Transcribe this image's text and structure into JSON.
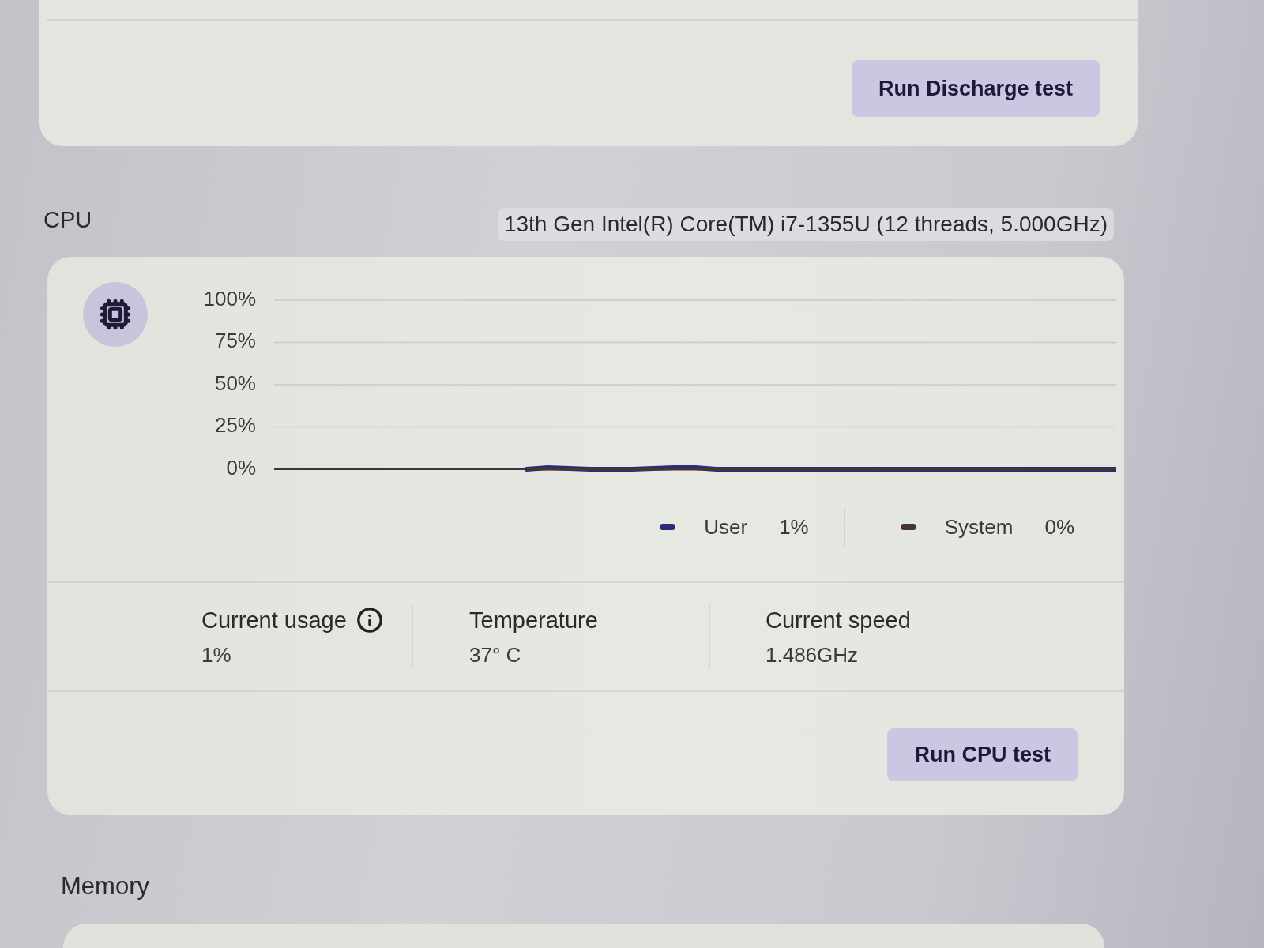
{
  "battery_card": {
    "button": "Run Discharge test"
  },
  "cpu": {
    "title": "CPU",
    "processor": "13th Gen Intel(R) Core(TM) i7-1355U (12 threads, 5.000GHz)",
    "chart_data": [
      {
        "type": "line",
        "ylim": [
          0,
          100
        ],
        "yticks": [
          {
            "value": 0,
            "label": "0%"
          },
          {
            "value": 25,
            "label": "25%"
          },
          {
            "value": 50,
            "label": "50%"
          },
          {
            "value": 75,
            "label": "75%"
          },
          {
            "value": 100,
            "label": "100%"
          }
        ],
        "grid": true,
        "series": [
          {
            "name": "User",
            "color": "#2e2a7a",
            "values": [
              null,
              null,
              null,
              null,
              null,
              null,
              null,
              null,
              null,
              null,
              null,
              null,
              0,
              1,
              0.5,
              0,
              0,
              0,
              0.5,
              1,
              1,
              0,
              0,
              0,
              0,
              0,
              0,
              0,
              0,
              0,
              0,
              0,
              0,
              0,
              0,
              0,
              0,
              0,
              0,
              0,
              0
            ]
          },
          {
            "name": "System",
            "color": "#4a3430",
            "values": [
              null,
              null,
              null,
              null,
              null,
              null,
              null,
              null,
              null,
              null,
              null,
              null,
              0,
              0,
              0,
              0,
              0,
              0,
              0,
              0,
              0,
              0,
              0,
              0,
              0,
              0,
              0,
              0,
              0,
              0,
              0,
              0,
              0,
              0,
              0,
              0,
              0,
              0,
              0,
              0,
              0
            ]
          }
        ]
      }
    ],
    "legend_readings": [
      "1%",
      "0%"
    ],
    "stats": [
      {
        "label": "Current usage",
        "value": "1%",
        "info": true
      },
      {
        "label": "Temperature",
        "value": "37° C",
        "info": false
      },
      {
        "label": "Current speed",
        "value": "1.486GHz",
        "info": false
      }
    ],
    "button": "Run CPU test"
  },
  "memory": {
    "title": "Memory"
  }
}
